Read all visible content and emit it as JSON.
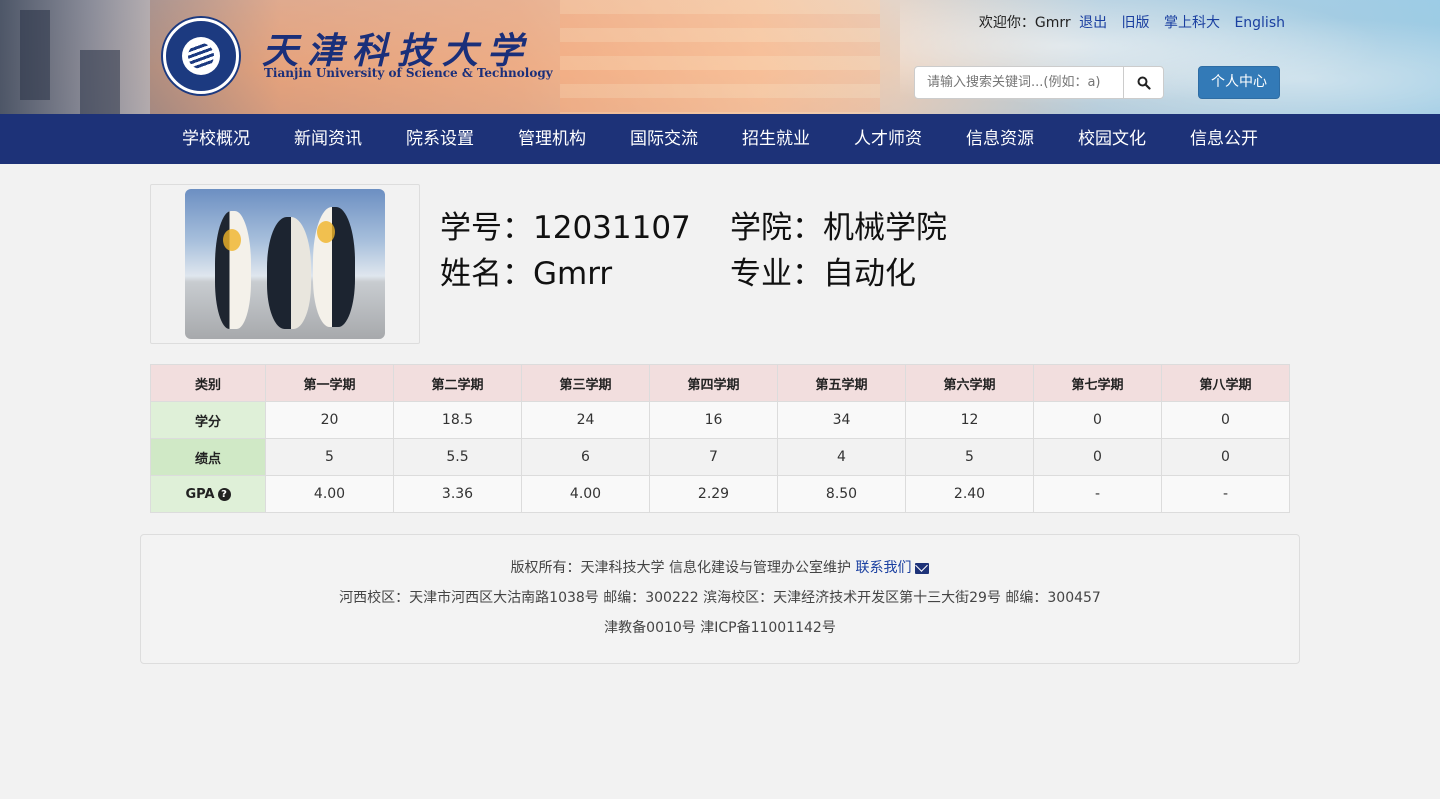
{
  "header": {
    "school_name_cn": "天津科技大学",
    "school_name_en": "Tianjin University of Science & Technology",
    "welcome": "欢迎你：",
    "username": "Gmrr",
    "logout": "退出",
    "links": [
      "旧版",
      "掌上科大",
      "English"
    ],
    "search_placeholder": "请输入搜索关键词...(例如：a)",
    "personal_center": "个人中心"
  },
  "nav": [
    "学校概况",
    "新闻资讯",
    "院系设置",
    "管理机构",
    "国际交流",
    "招生就业",
    "人才师资",
    "信息资源",
    "校园文化",
    "信息公开"
  ],
  "profile": {
    "student_id_label": "学号：",
    "student_id": "12031107",
    "college_label": "学院：",
    "college": "机械学院",
    "name_label": "姓名：",
    "name": "Gmrr",
    "major_label": "专业：",
    "major": "自动化"
  },
  "grades": {
    "headers": [
      "类别",
      "第一学期",
      "第二学期",
      "第三学期",
      "第四学期",
      "第五学期",
      "第六学期",
      "第七学期",
      "第八学期"
    ],
    "rows": [
      {
        "label": "学分",
        "values": [
          "20",
          "18.5",
          "24",
          "16",
          "34",
          "12",
          "0",
          "0"
        ]
      },
      {
        "label": "绩点",
        "values": [
          "5",
          "5.5",
          "6",
          "7",
          "4",
          "5",
          "0",
          "0"
        ]
      },
      {
        "label": "GPA",
        "values": [
          "4.00",
          "3.36",
          "4.00",
          "2.29",
          "8.50",
          "2.40",
          "-",
          "-"
        ]
      }
    ]
  },
  "footer": {
    "line1": "版权所有：天津科技大学 信息化建设与管理办公室维护",
    "contact": "联系我们",
    "line2": "河西校区：天津市河西区大沽南路1038号 邮编：300222 滨海校区：天津经济技术开发区第十三大街29号 邮编：300457",
    "line3": "津教备0010号 津ICP备11001142号"
  },
  "colors": {
    "nav_bg": "#1d3278",
    "primary_button": "#337ab7",
    "table_header": "#f2dede",
    "table_category": "#dff0d8"
  }
}
